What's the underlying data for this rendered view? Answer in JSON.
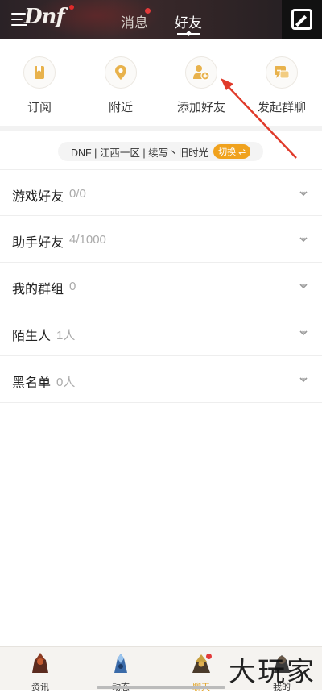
{
  "header": {
    "logo_text": "Dnf",
    "tabs": [
      {
        "label": "消息",
        "active": false,
        "has_dot": true
      },
      {
        "label": "好友",
        "active": true,
        "has_dot": false
      }
    ],
    "edit_icon": "edit-square-icon"
  },
  "shortcuts": [
    {
      "label": "订阅",
      "icon": "bookmark-icon"
    },
    {
      "label": "附近",
      "icon": "location-pin-icon"
    },
    {
      "label": "添加好友",
      "icon": "add-user-icon"
    },
    {
      "label": "发起群聊",
      "icon": "group-chat-icon"
    }
  ],
  "server": {
    "text": "DNF | 江西一区 | 续写丶旧时光",
    "switch_label": "切换 ⇌"
  },
  "friend_groups": [
    {
      "title": "游戏好友",
      "count": "0/0"
    },
    {
      "title": "助手好友",
      "count": "4/1000"
    },
    {
      "title": "我的群组",
      "count": "0"
    },
    {
      "title": "陌生人",
      "count": "1人"
    },
    {
      "title": "黑名单",
      "count": "0人"
    }
  ],
  "bottom_nav": [
    {
      "label": "资讯",
      "active": false
    },
    {
      "label": "动态",
      "active": false
    },
    {
      "label": "聊天",
      "active": true
    },
    {
      "label": "我的",
      "active": false
    }
  ],
  "watermark": "大玩家",
  "colors": {
    "accent": "#f0a21e",
    "header_bg": "#2a2226",
    "red_dot": "#e23a3a",
    "annotation_arrow": "#e03a2a"
  }
}
